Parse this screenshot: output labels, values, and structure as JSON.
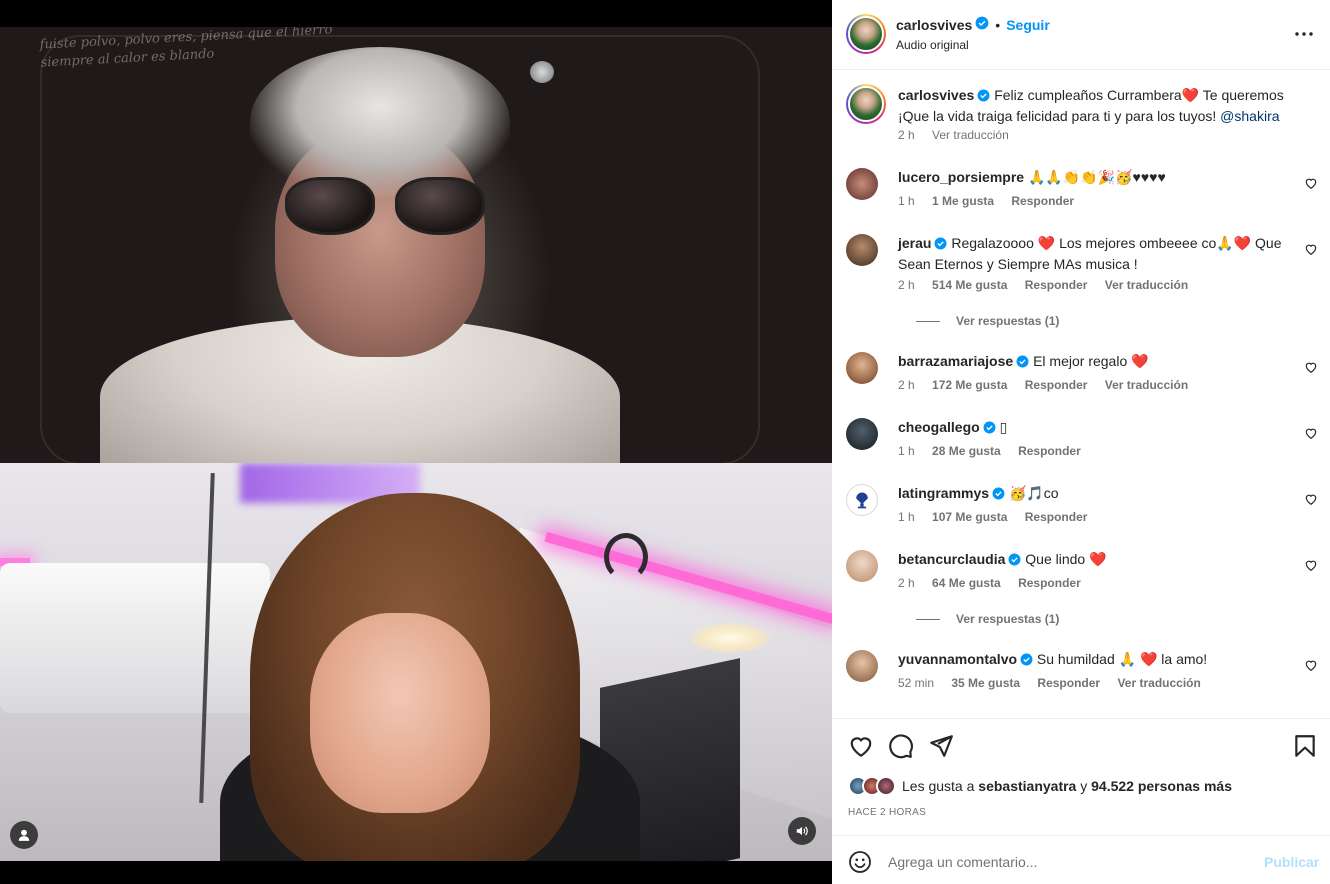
{
  "media": {
    "lyrics_overlay": "fuiste polvo, polvo eres, piensa que el hierro\nsiempre al calor es blando",
    "user_icon": "user-icon",
    "audio_icon": "speaker-icon"
  },
  "post": {
    "author": "carlosvives",
    "separator": "•",
    "follow_label": "Seguir",
    "audio_label": "Audio original",
    "more_icon": "more-options-icon"
  },
  "caption": {
    "author": "carlosvives",
    "text_part1": "Feliz cumpleaños Currambera",
    "heart": "❤️",
    "text_part2": " Te queremos ¡Que la vida traiga felicidad para ti y para los tuyos! ",
    "mention": "@shakira",
    "time": "2 h",
    "translate": "Ver traducción"
  },
  "comments": [
    {
      "user": "lucero_porsiempre",
      "verified": false,
      "text": "🙏🙏👏👏🎉🥳♥♥♥♥",
      "time": "1 h",
      "likes": "1 Me gusta",
      "reply": "Responder",
      "translate": ""
    },
    {
      "user": "jerau",
      "verified": true,
      "text": "Regalazoooo ❤️ Los mejores ombeeee co🙏❤️ Que Sean Eternos y Siempre MAs musica !",
      "time": "2 h",
      "likes": "514 Me gusta",
      "reply": "Responder",
      "translate": "Ver traducción",
      "replies": "Ver respuestas (1)"
    },
    {
      "user": "barrazamariajose",
      "verified": true,
      "text": "El mejor regalo ❤️",
      "time": "2 h",
      "likes": "172 Me gusta",
      "reply": "Responder",
      "translate": "Ver traducción"
    },
    {
      "user": "cheogallego",
      "verified": true,
      "text": "▯",
      "time": "1 h",
      "likes": "28 Me gusta",
      "reply": "Responder",
      "translate": ""
    },
    {
      "user": "latingrammys",
      "verified": true,
      "text": "🥳🎵co",
      "time": "1 h",
      "likes": "107 Me gusta",
      "reply": "Responder",
      "translate": ""
    },
    {
      "user": "betancurclaudia",
      "verified": true,
      "text": "Que lindo ❤️",
      "time": "2 h",
      "likes": "64 Me gusta",
      "reply": "Responder",
      "translate": "",
      "replies": "Ver respuestas (1)"
    },
    {
      "user": "yuvannamontalvo",
      "verified": true,
      "text": "Su humildad 🙏 ❤️ la amo!",
      "time": "52 min",
      "likes": "35 Me gusta",
      "reply": "Responder",
      "translate": "Ver traducción"
    }
  ],
  "actions": {
    "like_icon": "heart-icon",
    "comment_icon": "comment-icon",
    "share_icon": "send-icon",
    "save_icon": "bookmark-icon",
    "likes_prefix": "Les gusta a",
    "likes_user": "sebastianyatra",
    "likes_and": "y",
    "likes_count": "94.522 personas más",
    "time_ago": "HACE 2 HORAS"
  },
  "add_comment": {
    "emoji_icon": "emoji-icon",
    "placeholder": "Agrega un comentario...",
    "publish_label": "Publicar"
  },
  "colors": {
    "link_blue": "#0095f6",
    "verified_blue": "#0095f6",
    "publish_disabled": "#b2dffc",
    "muted_text": "#737373"
  }
}
